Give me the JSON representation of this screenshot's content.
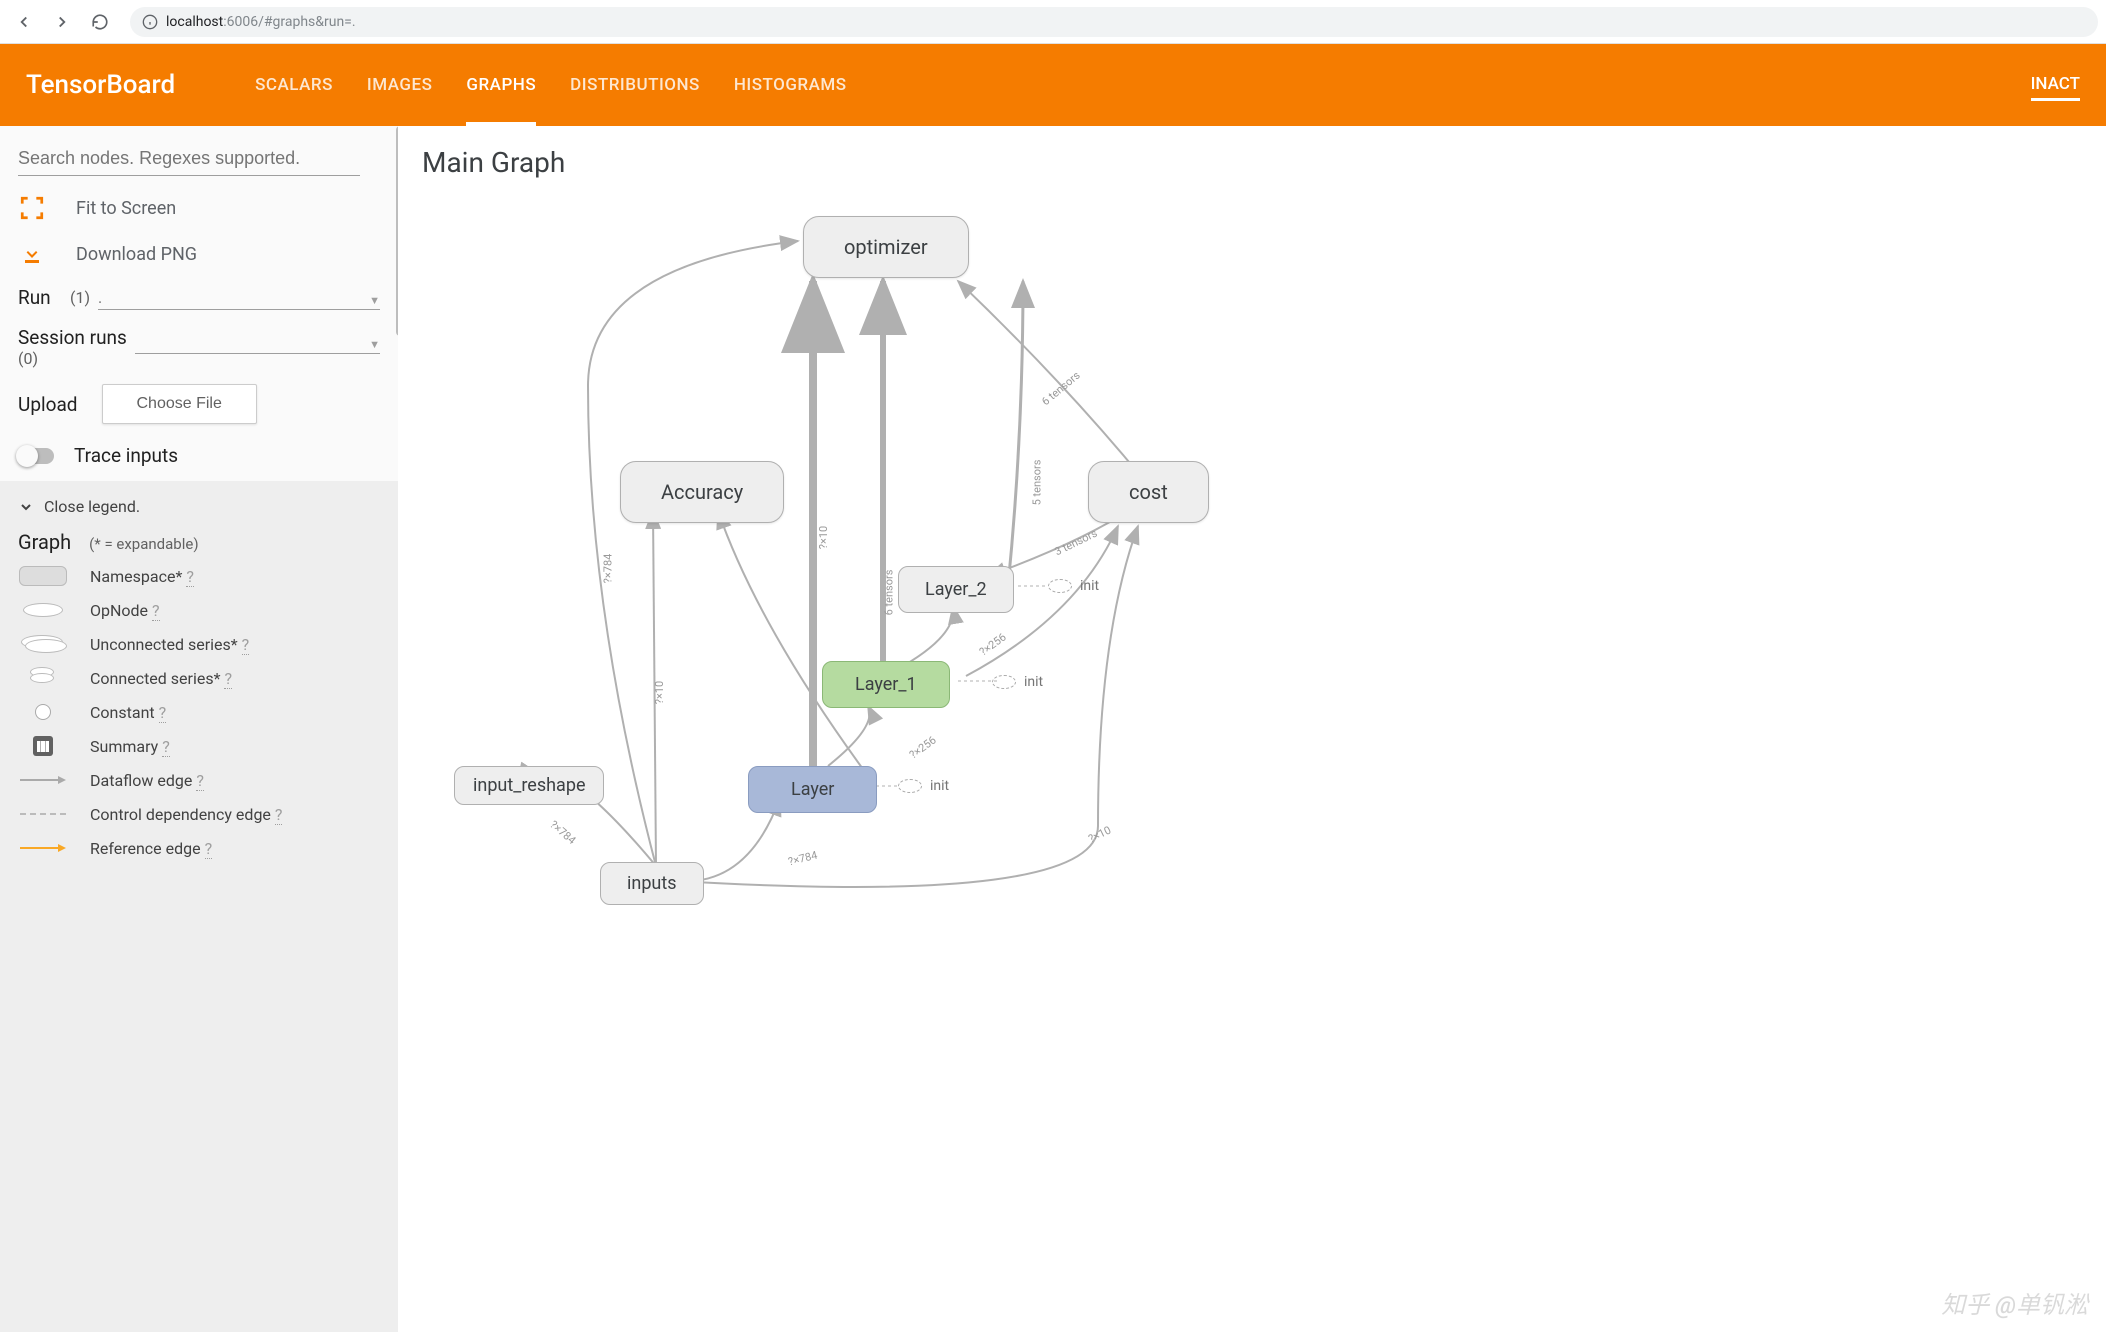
{
  "browser": {
    "url_host": "localhost",
    "url_port": ":6006",
    "url_path": "/#graphs&run=."
  },
  "header": {
    "title": "TensorBoard",
    "tabs": [
      "SCALARS",
      "IMAGES",
      "GRAPHS",
      "DISTRIBUTIONS",
      "HISTOGRAMS"
    ],
    "active_tab_index": 2,
    "inactive_label": "INACT"
  },
  "sidebar": {
    "search_placeholder": "Search nodes. Regexes supported.",
    "fit_label": "Fit to Screen",
    "download_label": "Download PNG",
    "run_label": "Run",
    "run_count": "(1)",
    "run_value": ".",
    "session_label": "Session runs",
    "session_count": "(0)",
    "upload_label": "Upload",
    "choose_file_label": "Choose File",
    "trace_label": "Trace inputs",
    "close_legend": "Close legend.",
    "graph_section": "Graph",
    "expandable_note": "(* = expandable)",
    "legend": {
      "namespace": "Namespace*",
      "opnode": "OpNode",
      "unconnected": "Unconnected series*",
      "connected": "Connected series*",
      "constant": "Constant",
      "summary": "Summary",
      "dataflow": "Dataflow edge",
      "control": "Control dependency edge",
      "reference": "Reference edge",
      "q": "?"
    }
  },
  "main": {
    "title": "Main Graph",
    "nodes": {
      "optimizer": "optimizer",
      "accuracy": "Accuracy",
      "cost": "cost",
      "layer2": "Layer_2",
      "layer1": "Layer_1",
      "layer": "Layer",
      "input_reshape": "input_reshape",
      "inputs": "inputs",
      "init": "init"
    },
    "edge_labels": {
      "t6": "6 tensors",
      "t5": "5 tensors",
      "t3": "3 tensors",
      "q256": "?×256",
      "q10": "?×10",
      "q784": "?×784"
    }
  },
  "watermark": "知乎 @单钒淞"
}
